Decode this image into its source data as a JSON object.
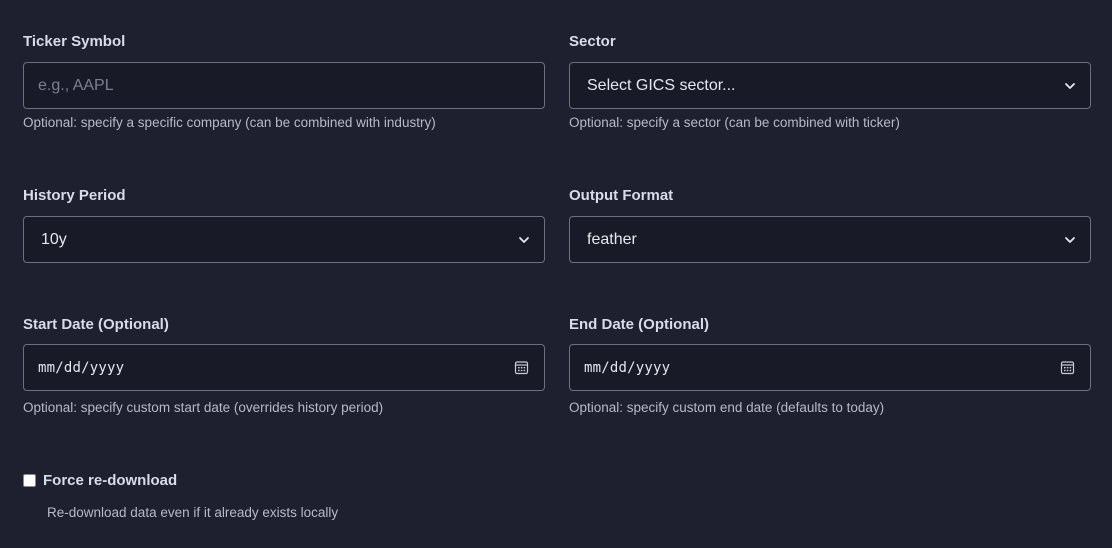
{
  "ticker": {
    "label": "Ticker Symbol",
    "placeholder": "e.g., AAPL",
    "value": "",
    "help": "Optional: specify a specific company (can be combined with industry)"
  },
  "sector": {
    "label": "Sector",
    "selected": "Select GICS sector...",
    "help": "Optional: specify a sector (can be combined with ticker)"
  },
  "history_period": {
    "label": "History Period",
    "selected": "10y"
  },
  "output_format": {
    "label": "Output Format",
    "selected": "feather"
  },
  "start_date": {
    "label": "Start Date (Optional)",
    "value": "mm/dd/yyyy",
    "help": "Optional: specify custom start date (overrides history period)"
  },
  "end_date": {
    "label": "End Date (Optional)",
    "value": "mm/dd/yyyy",
    "help": "Optional: specify custom end date (defaults to today)"
  },
  "force_redownload": {
    "label": "Force re-download",
    "checked": false,
    "help": "Re-download data even if it already exists locally"
  },
  "icons": {
    "select_arrow": "chevron-down-icon",
    "date_picker": "calendar-icon"
  }
}
